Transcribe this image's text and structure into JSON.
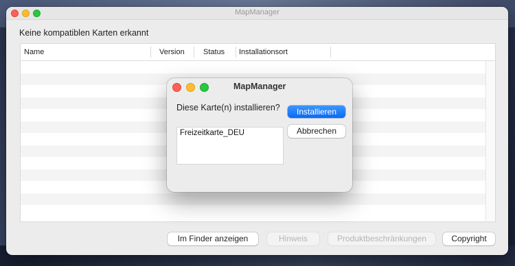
{
  "window": {
    "title": "MapManager",
    "heading": "Keine kompatiblen Karten erkannt"
  },
  "table": {
    "columns": [
      "Name",
      "Version",
      "Status",
      "Installationsort"
    ],
    "rows": []
  },
  "footer": {
    "buttons": {
      "finder": "Im Finder anzeigen",
      "hint": "Hinweis",
      "restrictions": "Produktbeschränkungen",
      "copyright": "Copyright"
    }
  },
  "dialog": {
    "title": "MapManager",
    "prompt": "Diese Karte(n) installieren?",
    "items": [
      "Freizeitkarte_DEU"
    ],
    "install_label": "Installieren",
    "cancel_label": "Abbrechen"
  },
  "colors": {
    "accent": "#0a6bf0",
    "close": "#fe5f57",
    "minimize": "#febc2e",
    "zoom": "#28c840"
  }
}
